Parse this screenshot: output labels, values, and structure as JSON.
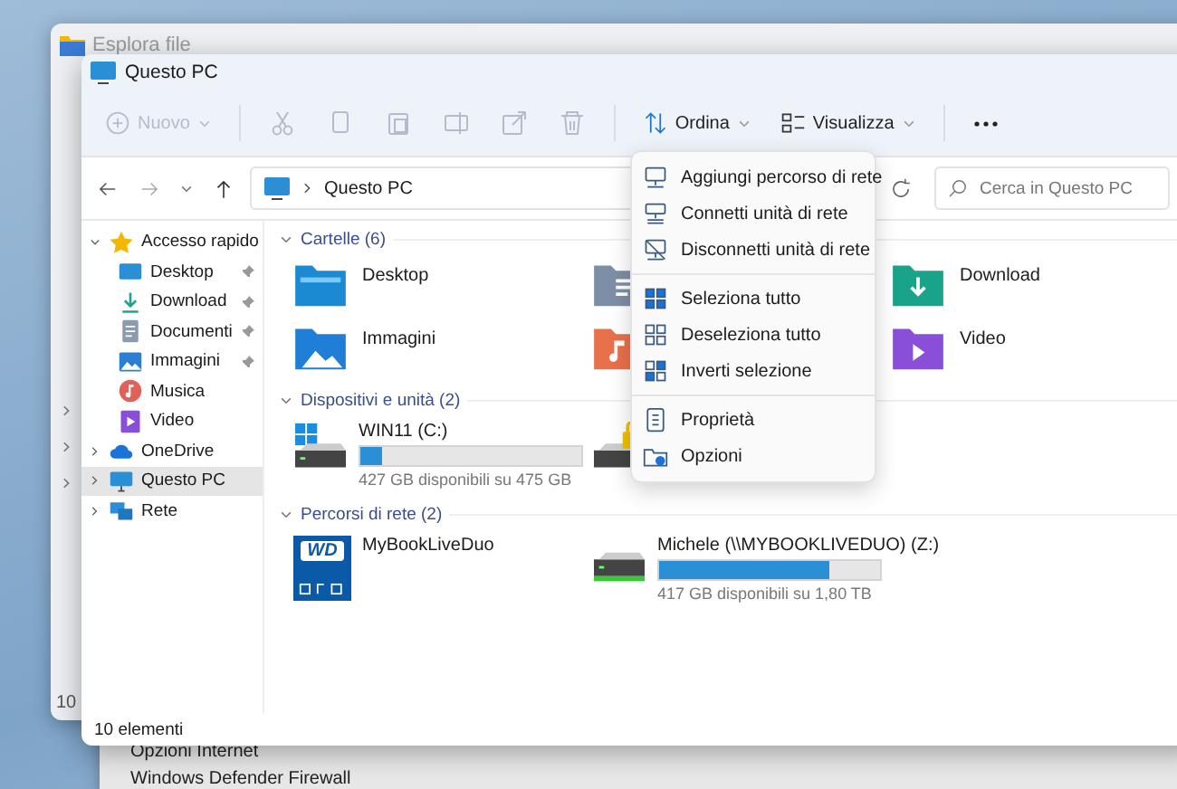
{
  "back_window": {
    "title": "Esplora file",
    "status": "10"
  },
  "lower_window": {
    "items": [
      "Opzioni Internet",
      "Windows Defender Firewall"
    ]
  },
  "window": {
    "title": "Questo PC"
  },
  "toolbar": {
    "new_button": {
      "label": "Nuovo",
      "disabled": true
    },
    "icon_buttons": [
      {
        "disabled": true
      },
      {
        "disabled": true
      },
      {
        "disabled": true
      },
      {
        "disabled": true
      },
      {
        "disabled": true
      },
      {
        "disabled": true
      }
    ],
    "sort_button": {
      "label": "Ordina"
    },
    "view_button": {
      "label": "Visualizza"
    }
  },
  "address_bar": {
    "path": "Questo PC"
  },
  "search": {
    "placeholder": "Cerca in Questo PC"
  },
  "sidebar": {
    "items": [
      {
        "label": "Accesso rapido",
        "expanded": true,
        "selected": false,
        "children": [
          {
            "label": "Desktop",
            "pinned": true,
            "selected": false
          },
          {
            "label": "Download",
            "pinned": true,
            "selected": false
          },
          {
            "label": "Documenti",
            "pinned": true,
            "selected": false
          },
          {
            "label": "Immagini",
            "pinned": true,
            "selected": false
          },
          {
            "label": "Musica",
            "pinned": false,
            "selected": false
          },
          {
            "label": "Video",
            "pinned": false,
            "selected": false
          }
        ]
      },
      {
        "label": "OneDrive",
        "expanded": false,
        "selected": false
      },
      {
        "label": "Questo PC",
        "expanded": false,
        "selected": true
      },
      {
        "label": "Rete",
        "expanded": false,
        "selected": false
      }
    ]
  },
  "folders": {
    "title": "Cartelle (6)",
    "items": [
      {
        "kind": "named",
        "label": "Desktop"
      },
      {
        "kind": "covered"
      },
      {
        "kind": "named",
        "label": "Download"
      },
      {
        "kind": "named",
        "label": "Immagini"
      },
      {
        "kind": "covered"
      },
      {
        "kind": "named",
        "label": "Video"
      }
    ]
  },
  "devices": {
    "title": "Dispositivi e unità (2)",
    "items": [
      {
        "kind": "drive",
        "label": "WIN11 (C:)",
        "level": 0.1,
        "reading": "427 GB disponibili su 475 GB"
      },
      {
        "kind": "locked"
      }
    ]
  },
  "network": {
    "title": "Percorsi di rete (2)",
    "items": [
      {
        "kind": "nas",
        "label": "MyBookLiveDuo",
        "logo": "WD"
      },
      {
        "kind": "drive",
        "label": "Michele (\\\\MYBOOKLIVEDUO) (Z:)",
        "level": 0.77,
        "reading": "417 GB disponibili su 1,80 TB"
      }
    ]
  },
  "menu": {
    "groups": [
      [
        {
          "label": "Aggiungi percorso di rete"
        },
        {
          "label": "Connetti unità di rete"
        },
        {
          "label": "Disconnetti unità di rete"
        }
      ],
      [
        {
          "label": "Seleziona tutto"
        },
        {
          "label": "Deseleziona tutto"
        },
        {
          "label": "Inverti selezione"
        }
      ],
      [
        {
          "label": "Proprietà"
        },
        {
          "label": "Opzioni"
        }
      ]
    ]
  },
  "status_bar": {
    "text": "10 elementi"
  }
}
